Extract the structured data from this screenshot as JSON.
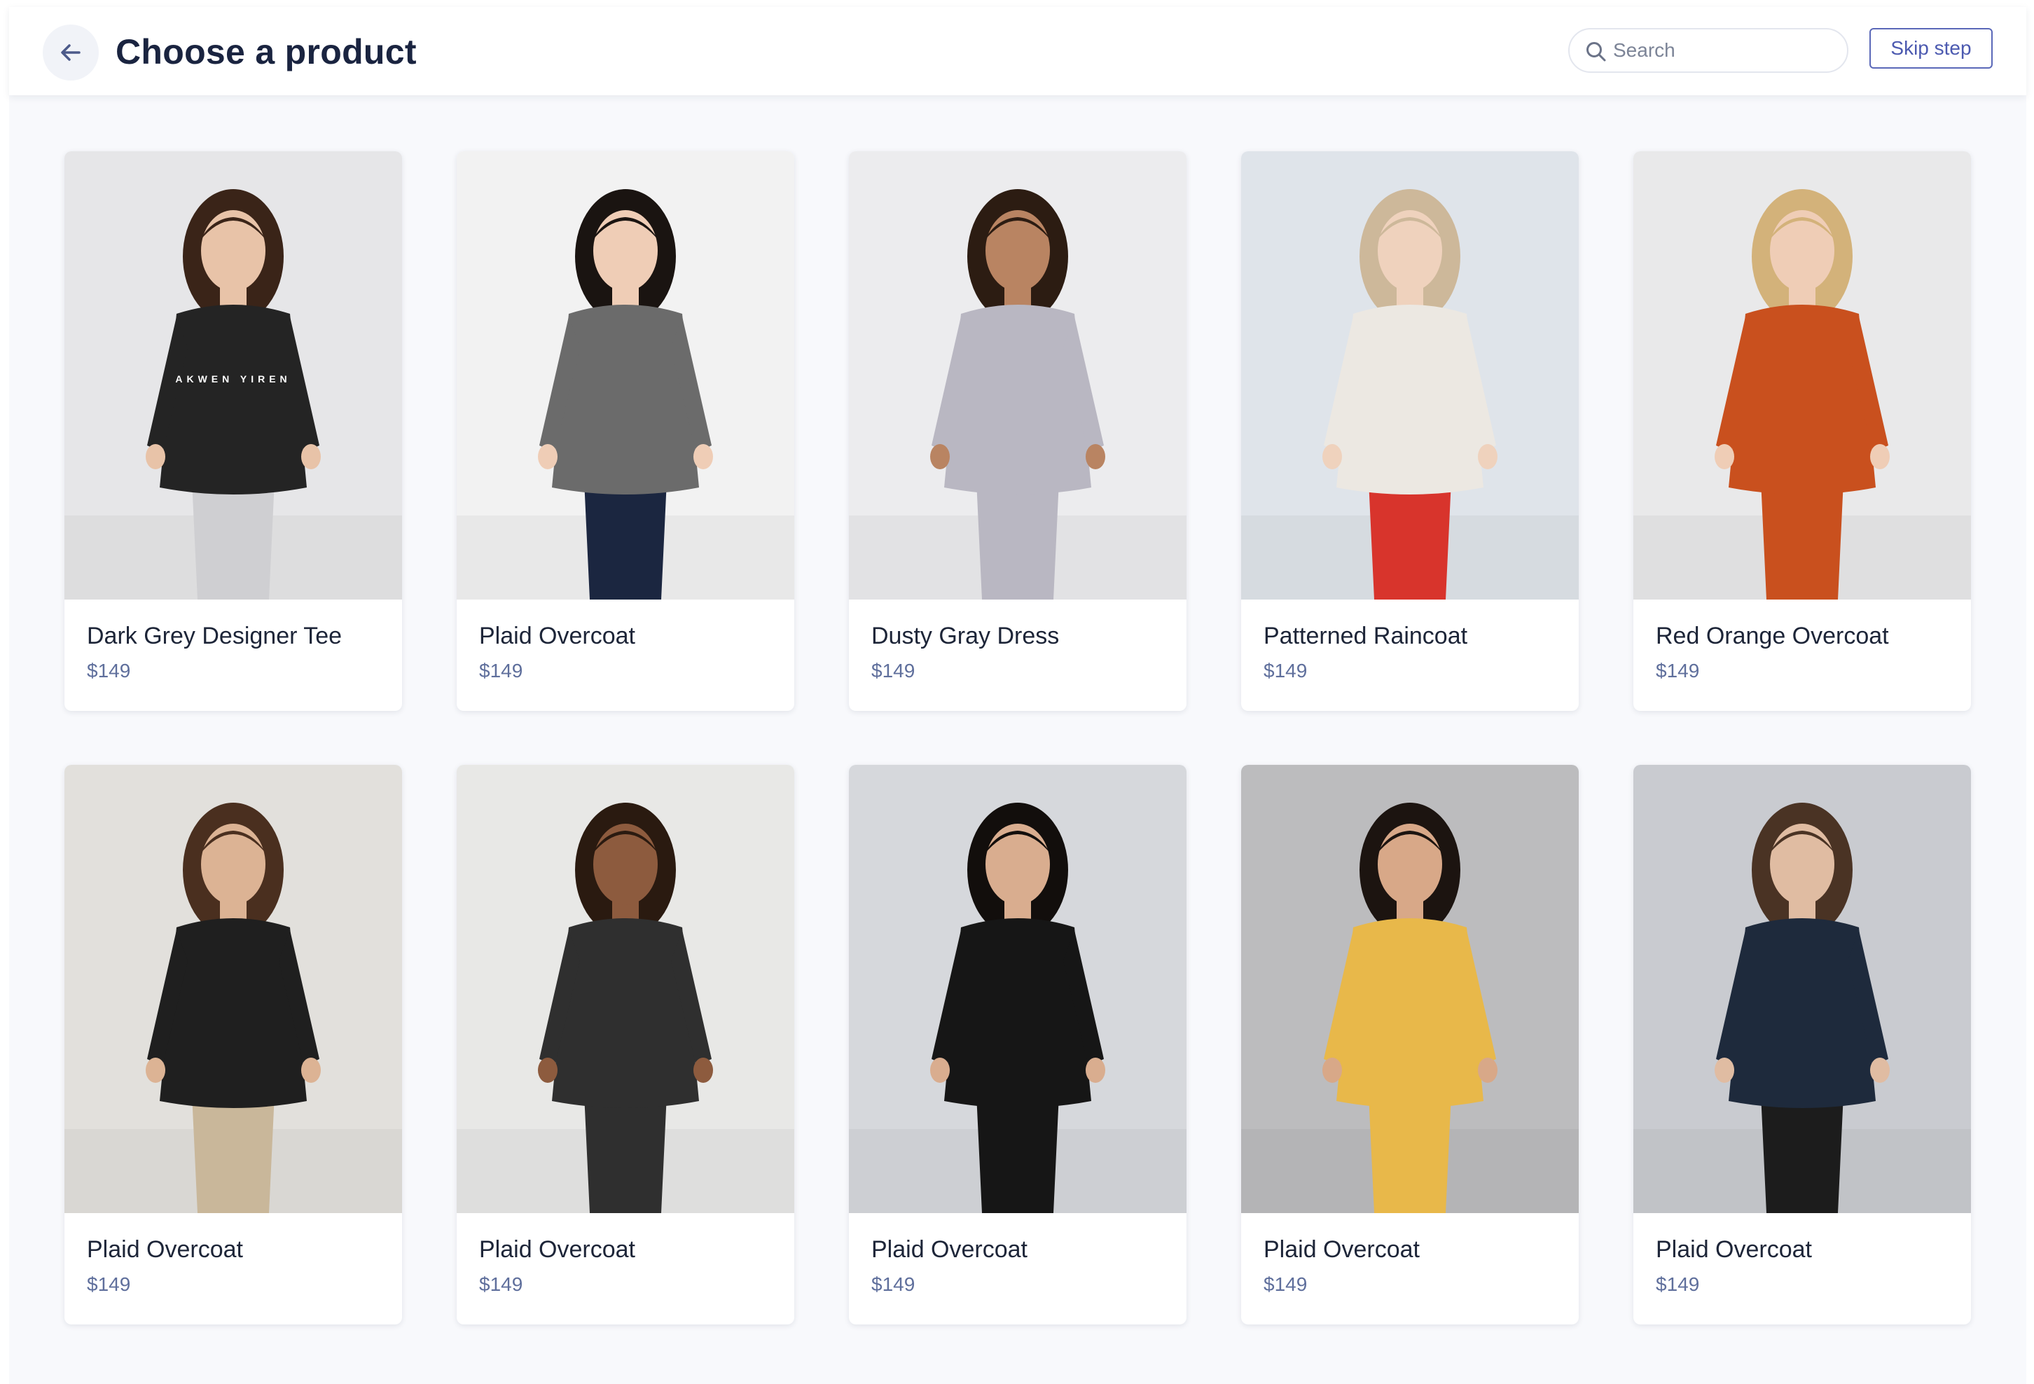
{
  "header": {
    "title": "Choose a product",
    "search_placeholder": "Search",
    "skip_label": "Skip step"
  },
  "products": [
    {
      "name": "Dark Grey Designer Tee",
      "price": "$149",
      "shirt_text": "AKWEN YIREN",
      "bg": "#e6e6e8",
      "garment": "#242424",
      "hair": "#3a2418",
      "skin": "#e8c3a8",
      "lower": "#cfcfd2"
    },
    {
      "name": "Plaid Overcoat",
      "price": "$149",
      "bg": "#f2f2f2",
      "garment": "#6b6b6b",
      "hair": "#1a1411",
      "skin": "#efcdb6",
      "lower": "#1b2640"
    },
    {
      "name": "Dusty Gray Dress",
      "price": "$149",
      "bg": "#ececee",
      "garment": "#b9b7c2",
      "hair": "#2c1c12",
      "skin": "#b98462",
      "lower": "#b9b7c2"
    },
    {
      "name": "Patterned Raincoat",
      "price": "$149",
      "bg": "#dfe4ea",
      "garment": "#ece8e2",
      "hair": "#cdb89a",
      "skin": "#efd2bd",
      "lower": "#d8342c"
    },
    {
      "name": "Red Orange Overcoat",
      "price": "$149",
      "bg": "#e9e9ea",
      "garment": "#c9501e",
      "hair": "#d3b27a",
      "skin": "#efcdb6",
      "lower": "#c9501e"
    },
    {
      "name": "Plaid Overcoat",
      "price": "$149",
      "bg": "#e2e0dc",
      "garment": "#1f1f1f",
      "hair": "#4a2f1f",
      "skin": "#dcb394",
      "lower": "#c9b79a"
    },
    {
      "name": "Plaid Overcoat",
      "price": "$149",
      "bg": "#e8e8e6",
      "garment": "#2f2f2f",
      "hair": "#2a1a10",
      "skin": "#8d5b3e",
      "lower": "#2f2f2f"
    },
    {
      "name": "Plaid Overcoat",
      "price": "$149",
      "bg": "#d6d8dc",
      "garment": "#161616",
      "hair": "#120e0c",
      "skin": "#d9ad8f",
      "lower": "#161616"
    },
    {
      "name": "Plaid Overcoat",
      "price": "$149",
      "bg": "#bcbcbe",
      "garment": "#e8b84a",
      "hair": "#1c1410",
      "skin": "#d8a888",
      "lower": "#e8b84a"
    },
    {
      "name": "Plaid Overcoat",
      "price": "$149",
      "bg": "#c9cbd0",
      "garment": "#1e2a3c",
      "hair": "#4a3324",
      "skin": "#e0bca2",
      "lower": "#1c1c1c"
    }
  ],
  "icons": {
    "back": "arrow-left-icon",
    "search": "search-icon"
  },
  "colors": {
    "title": "#1a2440",
    "accent": "#4c5ab0",
    "price": "#5f6f9c",
    "page_bg": "#f8f9fc"
  }
}
